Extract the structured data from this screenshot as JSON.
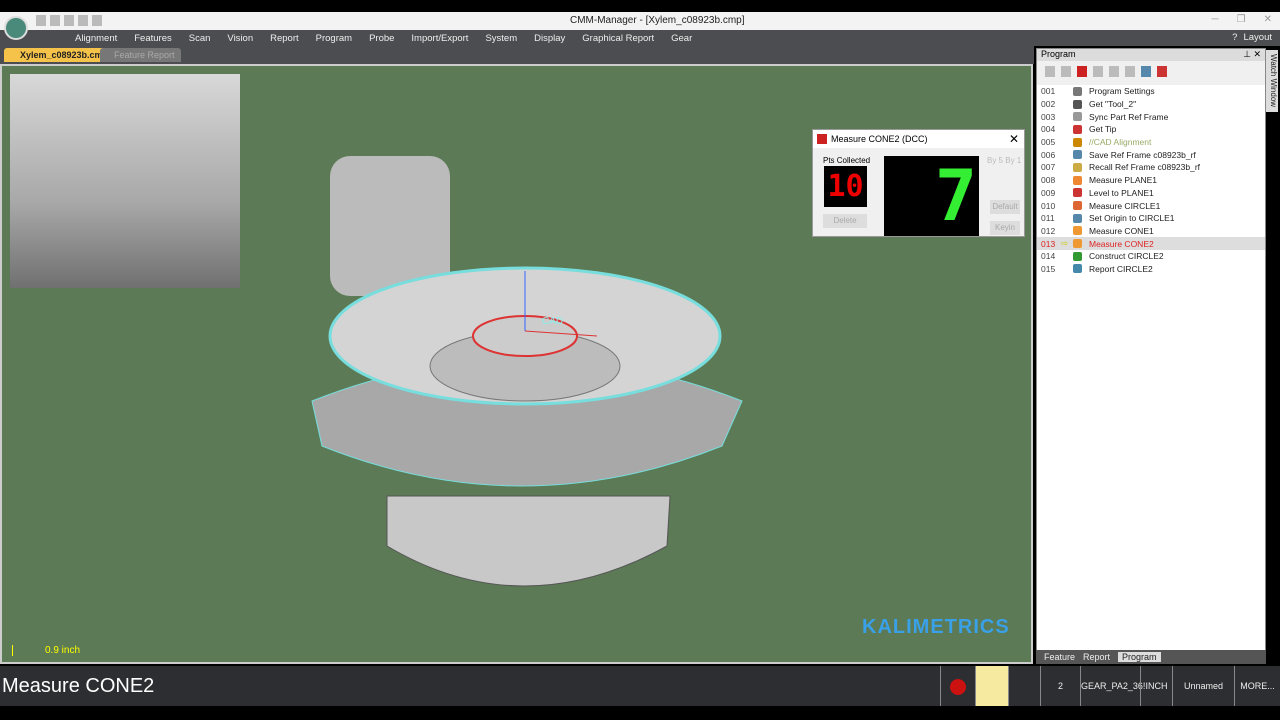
{
  "app": {
    "title": "CMM-Manager - [Xylem_c08923b.cmp]",
    "layout_label": "Layout"
  },
  "menu": [
    "Alignment",
    "Features",
    "Scan",
    "Vision",
    "Report",
    "Program",
    "Probe",
    "Import/Export",
    "System",
    "Display",
    "Graphical Report",
    "Gear"
  ],
  "doc_tabs": [
    "Xylem_c08923b.cmp",
    "Feature Report"
  ],
  "viewport": {
    "scale_label": "0.9 inch",
    "cad_label": "CAD",
    "brand": "KALIMETRICS"
  },
  "dialog": {
    "title": "Measure CONE2 (DCC)",
    "pts_label": "Pts Collected",
    "pts_value": "10",
    "big_value": "7",
    "by5": "By 5",
    "by1": "By 1",
    "delete": "Delete",
    "default": "Default",
    "keyin": "Keyin"
  },
  "program": {
    "title": "Program",
    "watch": "Watch Window",
    "current": "013",
    "items": [
      {
        "n": "001",
        "label": "Program Settings",
        "icon": "wrench-icon",
        "color": "#777"
      },
      {
        "n": "002",
        "label": "Get \"Tool_2\"",
        "icon": "tool-icon",
        "color": "#555"
      },
      {
        "n": "003",
        "label": "Sync Part Ref Frame",
        "icon": "sync-icon",
        "color": "#999"
      },
      {
        "n": "004",
        "label": "Get Tip",
        "icon": "tip-icon",
        "color": "#c33"
      },
      {
        "n": "005",
        "label": "//CAD Alignment",
        "icon": "cad-icon",
        "color": "#c80"
      },
      {
        "n": "006",
        "label": "Save Ref Frame c08923b_rf",
        "icon": "save-frame-icon",
        "color": "#58a"
      },
      {
        "n": "007",
        "label": "Recall Ref Frame c08923b_rf",
        "icon": "recall-frame-icon",
        "color": "#ca4"
      },
      {
        "n": "008",
        "label": "Measure PLANE1",
        "icon": "plane-icon",
        "color": "#e83"
      },
      {
        "n": "009",
        "label": "Level to PLANE1",
        "icon": "level-icon",
        "color": "#c33"
      },
      {
        "n": "010",
        "label": "Measure CIRCLE1",
        "icon": "circle-icon",
        "color": "#d63"
      },
      {
        "n": "011",
        "label": "Set Origin to CIRCLE1",
        "icon": "origin-icon",
        "color": "#58a"
      },
      {
        "n": "012",
        "label": "Measure CONE1",
        "icon": "cone-icon",
        "color": "#e93"
      },
      {
        "n": "013",
        "label": "Measure CONE2",
        "icon": "cone-icon",
        "color": "#e93"
      },
      {
        "n": "014",
        "label": "Construct CIRCLE2",
        "icon": "circle-icon",
        "color": "#393"
      },
      {
        "n": "015",
        "label": "Report CIRCLE2",
        "icon": "report-icon",
        "color": "#48a"
      }
    ]
  },
  "panel_tabs": [
    "Feature",
    "Report",
    "Program"
  ],
  "status": {
    "message": "Measure CONE2",
    "probe_count": "2",
    "probe_name": "GEAR_PA2_36!",
    "units": "INCH",
    "frame": "Unnamed",
    "more": "MORE..."
  }
}
